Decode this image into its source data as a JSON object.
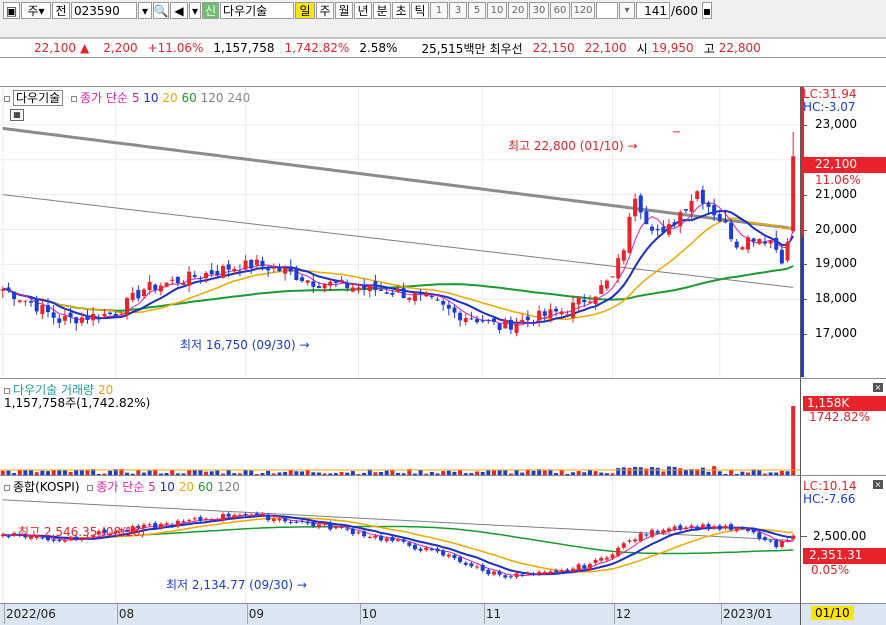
{
  "toolbar": {
    "type_select": "주",
    "prev_label": "전",
    "code": "023590",
    "new_badge": "신",
    "stock_name": "다우기술",
    "periods": [
      "일",
      "주",
      "월",
      "년",
      "분",
      "초",
      "틱"
    ],
    "selected_period": "일",
    "intervals": [
      "1",
      "3",
      "5",
      "10",
      "20",
      "30",
      "60",
      "120"
    ],
    "count": "141",
    "total": "/600"
  },
  "quote": {
    "price": "22,100",
    "change": "2,200",
    "change_pct": "+11.06%",
    "volume": "1,157,758",
    "vol_ratio": "1,742.82%",
    "turnover": "2.58%",
    "amount": "25,515백만",
    "best_ask_label": "최우선",
    "best_ask": "22,150",
    "best_bid": "22,100",
    "open_label": "시",
    "open": "19,950",
    "high_label": "고",
    "high": "22,800"
  },
  "price_pane": {
    "legend_name": "다우기술",
    "legend_ma": "종가 단순",
    "ma": [
      "5",
      "10",
      "20",
      "60",
      "120",
      "240"
    ],
    "lc": "LC:31.94",
    "hc": "HC:-3.07",
    "current": "22,100",
    "current_pct": "11.06%",
    "y_labels": [
      "23,000",
      "22,000",
      "21,000",
      "20,000",
      "19,000",
      "18,000",
      "17,000"
    ],
    "high_ann": "최고 22,800 (01/10)",
    "low_ann": "최저 16,750 (09/30)"
  },
  "volume_pane": {
    "legend_name": "다우기술 거래량",
    "legend_ma": "20",
    "value": "1,157,758주(1,742.82%)",
    "current": "1,158K",
    "current_pct": "1742.82%"
  },
  "index_pane": {
    "legend_name": "종합(KOSPI)",
    "legend_ma": "종가 단순",
    "ma": [
      "5",
      "10",
      "20",
      "60",
      "120"
    ],
    "lc": "LC:10.14",
    "hc": "HC:-7.66",
    "y_label": "2,500.00",
    "current": "2,351.31",
    "current_pct": "0.05%",
    "high_ann": "최고 2,546.35 (08/16)",
    "low_ann": "최저 2,134.77 (09/30)"
  },
  "x_axis": {
    "labels": [
      "2022/06",
      "08",
      "09",
      "10",
      "11",
      "12",
      "2023/01"
    ],
    "current_date": "01/10"
  },
  "colors": {
    "up": "#e8232b",
    "down": "#1a3cd8",
    "ma5": "#e020b0",
    "ma10": "#1a30c0",
    "ma20": "#f0a800",
    "ma60": "#1a9a30",
    "ma120": "#808080",
    "ma240": "#8c8c8c",
    "highlight": "#ffe600"
  },
  "chart_data": {
    "type": "candlestick",
    "price_high": 22800,
    "price_low": 16750,
    "last_close": 22100,
    "prev_close": 19900,
    "last_open": 19950,
    "x_labels": [
      "2022/06",
      "08",
      "09",
      "10",
      "11",
      "12",
      "2023/01"
    ],
    "ylim": [
      16000,
      23800
    ],
    "index_high": 2546.35,
    "index_low": 2134.77,
    "index_last": 2351.31
  }
}
